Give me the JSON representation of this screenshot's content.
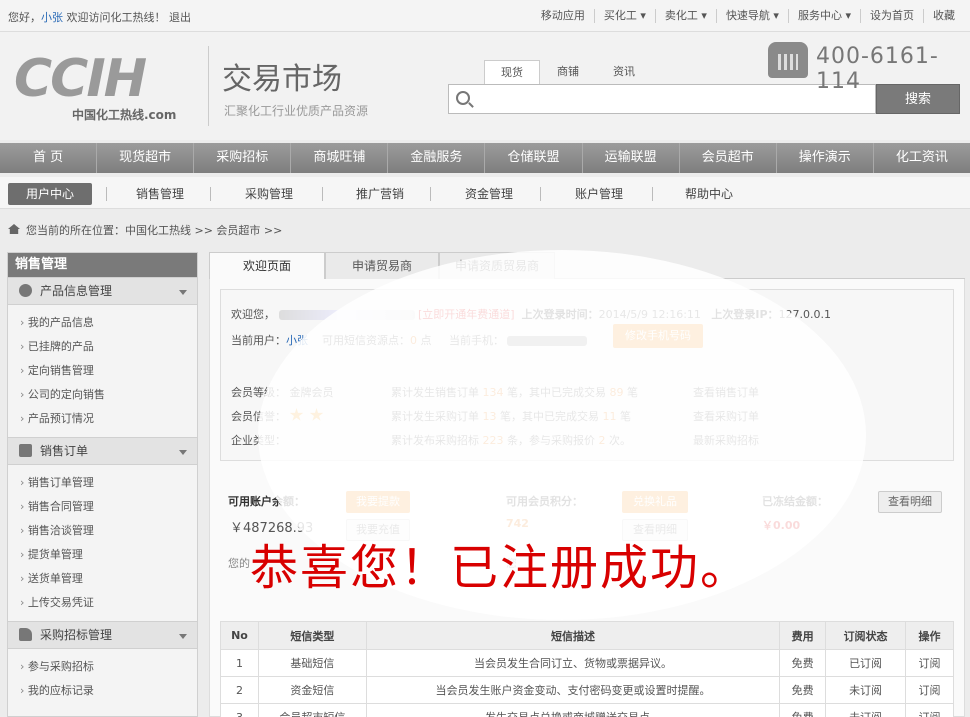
{
  "topbar": {
    "greeting": "您好，",
    "username": "小张",
    "welcome": "欢迎访问化工热线！",
    "logout": "退出",
    "links": [
      "移动应用",
      "买化工 ▾",
      "卖化工 ▾",
      "快速导航 ▾",
      "服务中心 ▾",
      "设为首页",
      "收藏"
    ]
  },
  "header": {
    "logo_text": "CCIH",
    "logo_sub": "中国化工热线.com",
    "title": "交易市场",
    "subtitle": "汇聚化工行业优质产品资源",
    "search_tabs": [
      "现货",
      "商铺",
      "资讯"
    ],
    "search_placeholder": "",
    "search_button": "搜索",
    "phone": "400-6161-114"
  },
  "mainnav": [
    "首 页",
    "现货超市",
    "采购招标",
    "商城旺铺",
    "金融服务",
    "仓储联盟",
    "运输联盟",
    "会员超市",
    "操作演示",
    "化工资讯"
  ],
  "subnav": [
    "用户中心",
    "销售管理",
    "采购管理",
    "推广营销",
    "资金管理",
    "账户管理",
    "帮助中心"
  ],
  "breadcrumb": "您当前的所在位置：中国化工热线 >> 会员超市 >>",
  "sidebar": {
    "title": "销售管理",
    "groups": [
      {
        "label": "产品信息管理",
        "items": [
          "我的产品信息",
          "已挂牌的产品",
          "定向销售管理",
          "公司的定向销售",
          "产品预订情况"
        ]
      },
      {
        "label": "销售订单",
        "items": [
          "销售订单管理",
          "销售合同管理",
          "销售洽谈管理",
          "提货单管理",
          "送货单管理",
          "上传交易凭证"
        ]
      },
      {
        "label": "采购招标管理",
        "items": [
          "参与采购招标",
          "我的应标记录"
        ]
      }
    ]
  },
  "tabs": [
    "欢迎页面",
    "申请贸易商",
    "申请资质贸易商"
  ],
  "welcome": {
    "hello": "欢迎您，",
    "vip_link": "[立即开通年费通道]",
    "last_login_label": "上次登录时间：",
    "last_login_time": "2014/5/9 12:16:11",
    "last_ip_label": "上次登录IP：",
    "last_ip": "127.0.0.1",
    "current_user_label": "当前用户：",
    "current_user": "小张",
    "sms_label": "可用短信资源点：",
    "sms_points": "0",
    "sms_unit": "点",
    "phone_label": "当前手机：",
    "change_phone_button": "修改手机号码",
    "level_label": "会员等级：",
    "level_value": "金牌会员",
    "credit_label": "会员信誉：",
    "company_label": "企业类型：",
    "sales_text_a": "累计发生销售订单",
    "sales_count": "134",
    "sales_text_b": "笔，其中已完成交易",
    "sales_done": "89",
    "sales_text_c": "笔",
    "purchase_text_a": "累计发生采购订单",
    "purchase_count": "13",
    "purchase_text_b": "笔，其中已完成交易",
    "purchase_done": "11",
    "purchase_text_c": "笔",
    "tender_text_a": "累计发布采购招标",
    "tender_count": "223",
    "tender_text_b": "条，参与采购报价",
    "tender_quotes": "2",
    "tender_text_c": "次。",
    "link_sales": "查看销售订单",
    "link_purchase": "查看采购订单",
    "link_tender": "最新采购招标"
  },
  "account": {
    "balance_label": "可用账户余额：",
    "balance": "￥487268.93",
    "withdraw_button": "我要提款",
    "recharge_button": "我要充值",
    "points_label": "可用会员积分：",
    "points": "742",
    "gift_button": "兑换礼品",
    "detail_button": "查看明细",
    "frozen_label": "已冻结金额：",
    "frozen": "￥0.00",
    "frozen_detail_button": "查看明细",
    "partial_left": "您的",
    "partial_mid": "您"
  },
  "sms_table": {
    "headers": [
      "No",
      "短信类型",
      "短信描述",
      "费用",
      "订阅状态",
      "操作"
    ],
    "rows": [
      [
        "1",
        "基础短信",
        "当会员发生合同订立、货物或票据异议。",
        "免费",
        "已订阅",
        "订阅"
      ],
      [
        "2",
        "资金短信",
        "当会员发生账户资金变动、支付密码变更或设置时提醒。",
        "免费",
        "未订阅",
        "订阅"
      ],
      [
        "3",
        "会员超市短信",
        "发生交易点兑换或商城赠送交易点。",
        "免费",
        "未订阅",
        "订阅"
      ]
    ]
  },
  "overlay_text": "恭喜您！已注册成功。"
}
